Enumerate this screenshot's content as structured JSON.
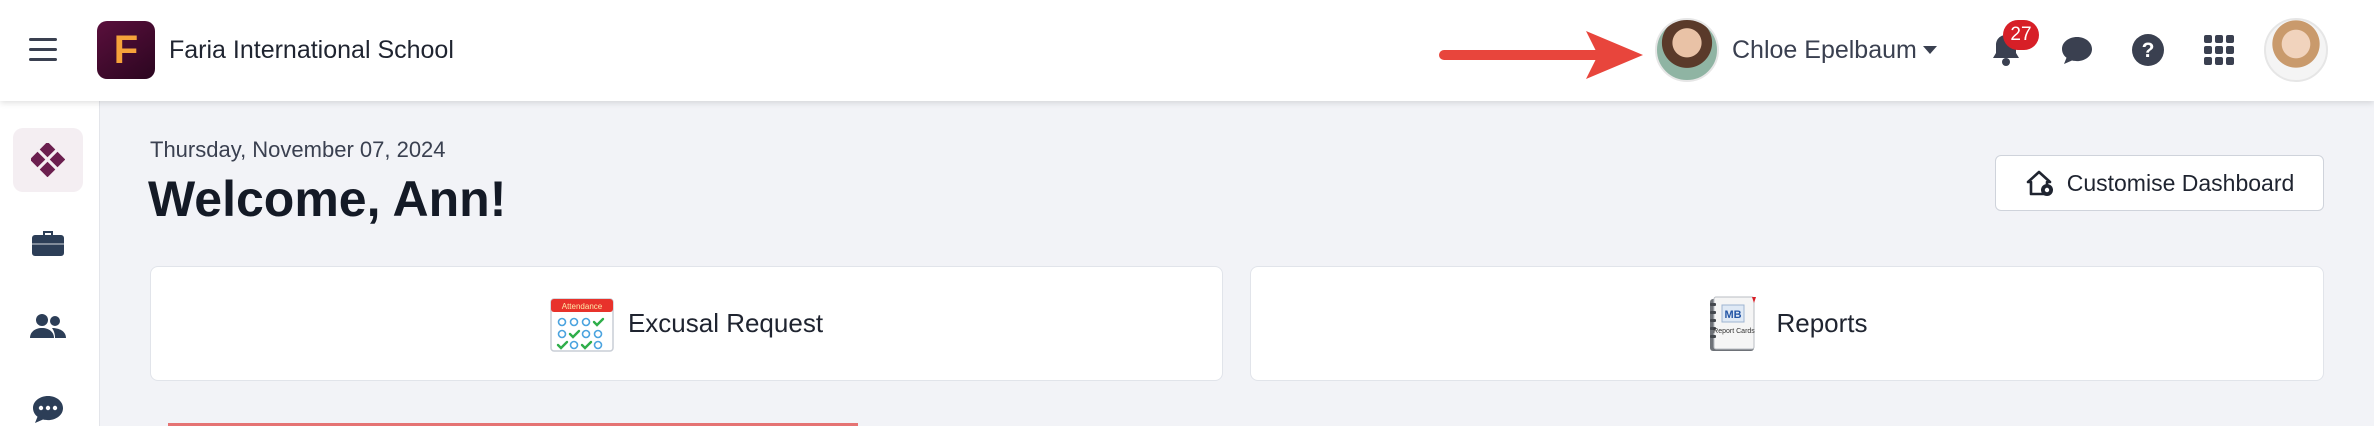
{
  "header": {
    "brand_letter": "F",
    "brand_name": "Faria International School",
    "user_name": "Chloe Epelbaum",
    "notification_count": "27",
    "colors": {
      "badge": "#d71f27",
      "arrow": "#e8453c",
      "brand": "#5a0f3c"
    }
  },
  "sidebar": {
    "items": [
      {
        "icon": "dashboard-diamond-icon",
        "active": true
      },
      {
        "icon": "briefcase-icon",
        "active": false
      },
      {
        "icon": "people-icon",
        "active": false
      },
      {
        "icon": "chat-icon",
        "active": false
      }
    ]
  },
  "main": {
    "date": "Thursday, November 07, 2024",
    "welcome": "Welcome, Ann!",
    "customise_label": "Customise Dashboard",
    "cards": [
      {
        "label": "Excusal Request",
        "icon": "attendance-calendar-icon",
        "icon_text": "Attendance"
      },
      {
        "label": "Reports",
        "icon": "report-cards-icon",
        "icon_text": "Report Cards",
        "icon_mark": "MB"
      }
    ]
  }
}
